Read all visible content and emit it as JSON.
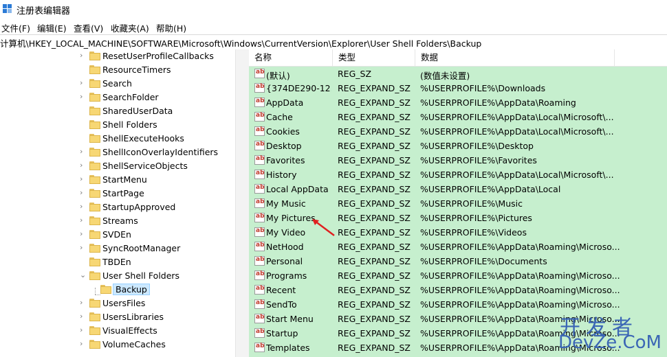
{
  "window": {
    "title": "注册表编辑器"
  },
  "menu": [
    "文件(F)",
    "编辑(E)",
    "查看(V)",
    "收藏夹(A)",
    "帮助(H)"
  ],
  "address": "计算机\\HKEY_LOCAL_MACHINE\\SOFTWARE\\Microsoft\\Windows\\CurrentVersion\\Explorer\\User Shell Folders\\Backup",
  "tree": [
    {
      "label": "ResetUserProfileCallbacks",
      "expander": "›"
    },
    {
      "label": "ResourceTimers",
      "expander": ""
    },
    {
      "label": "Search",
      "expander": "›"
    },
    {
      "label": "SearchFolder",
      "expander": "›"
    },
    {
      "label": "SharedUserData",
      "expander": ""
    },
    {
      "label": "Shell Folders",
      "expander": ""
    },
    {
      "label": "ShellExecuteHooks",
      "expander": ""
    },
    {
      "label": "ShellIconOverlayIdentifiers",
      "expander": "›"
    },
    {
      "label": "ShellServiceObjects",
      "expander": "›"
    },
    {
      "label": "StartMenu",
      "expander": "›"
    },
    {
      "label": "StartPage",
      "expander": "›"
    },
    {
      "label": "StartupApproved",
      "expander": "›"
    },
    {
      "label": "Streams",
      "expander": "›"
    },
    {
      "label": "SVDEn",
      "expander": "›"
    },
    {
      "label": "SyncRootManager",
      "expander": "›"
    },
    {
      "label": "TBDEn",
      "expander": ""
    },
    {
      "label": "User Shell Folders",
      "expander": "⌄"
    },
    {
      "label": "Backup",
      "expander": ""
    },
    {
      "label": "UsersFiles",
      "expander": "›"
    },
    {
      "label": "UsersLibraries",
      "expander": "›"
    },
    {
      "label": "VisualEffects",
      "expander": "›"
    },
    {
      "label": "VolumeCaches",
      "expander": "›"
    }
  ],
  "columns": [
    "名称",
    "类型",
    "数据"
  ],
  "rows": [
    {
      "name": "(默认)",
      "type": "REG_SZ",
      "data": "(数值未设置)"
    },
    {
      "name": "{374DE290-12...",
      "type": "REG_EXPAND_SZ",
      "data": "%USERPROFILE%\\Downloads"
    },
    {
      "name": "AppData",
      "type": "REG_EXPAND_SZ",
      "data": "%USERPROFILE%\\AppData\\Roaming"
    },
    {
      "name": "Cache",
      "type": "REG_EXPAND_SZ",
      "data": "%USERPROFILE%\\AppData\\Local\\Microsoft\\..."
    },
    {
      "name": "Cookies",
      "type": "REG_EXPAND_SZ",
      "data": "%USERPROFILE%\\AppData\\Local\\Microsoft\\..."
    },
    {
      "name": "Desktop",
      "type": "REG_EXPAND_SZ",
      "data": "%USERPROFILE%\\Desktop"
    },
    {
      "name": "Favorites",
      "type": "REG_EXPAND_SZ",
      "data": "%USERPROFILE%\\Favorites"
    },
    {
      "name": "History",
      "type": "REG_EXPAND_SZ",
      "data": "%USERPROFILE%\\AppData\\Local\\Microsoft\\..."
    },
    {
      "name": "Local AppData",
      "type": "REG_EXPAND_SZ",
      "data": "%USERPROFILE%\\AppData\\Local"
    },
    {
      "name": "My Music",
      "type": "REG_EXPAND_SZ",
      "data": "%USERPROFILE%\\Music"
    },
    {
      "name": "My Pictures",
      "type": "REG_EXPAND_SZ",
      "data": "%USERPROFILE%\\Pictures"
    },
    {
      "name": "My Video",
      "type": "REG_EXPAND_SZ",
      "data": "%USERPROFILE%\\Videos"
    },
    {
      "name": "NetHood",
      "type": "REG_EXPAND_SZ",
      "data": "%USERPROFILE%\\AppData\\Roaming\\Microso..."
    },
    {
      "name": "Personal",
      "type": "REG_EXPAND_SZ",
      "data": "%USERPROFILE%\\Documents"
    },
    {
      "name": "Programs",
      "type": "REG_EXPAND_SZ",
      "data": "%USERPROFILE%\\AppData\\Roaming\\Microso..."
    },
    {
      "name": "Recent",
      "type": "REG_EXPAND_SZ",
      "data": "%USERPROFILE%\\AppData\\Roaming\\Microso..."
    },
    {
      "name": "SendTo",
      "type": "REG_EXPAND_SZ",
      "data": "%USERPROFILE%\\AppData\\Roaming\\Microso..."
    },
    {
      "name": "Start Menu",
      "type": "REG_EXPAND_SZ",
      "data": "%USERPROFILE%\\AppData\\Roaming\\Microso..."
    },
    {
      "name": "Startup",
      "type": "REG_EXPAND_SZ",
      "data": "%USERPROFILE%\\AppData\\Roaming\\Microso..."
    },
    {
      "name": "Templates",
      "type": "REG_EXPAND_SZ",
      "data": "%USERPROFILE%\\AppData\\Roaming\\Microso..."
    }
  ],
  "value_icon_text": "ab",
  "watermark": {
    "top": "开发者",
    "bottom": "DevZe.CoM"
  },
  "colors": {
    "highlight": "#c6efce",
    "selected": "#cce8ff",
    "arrow": "#e02020",
    "watermark": "#3b66b5"
  }
}
